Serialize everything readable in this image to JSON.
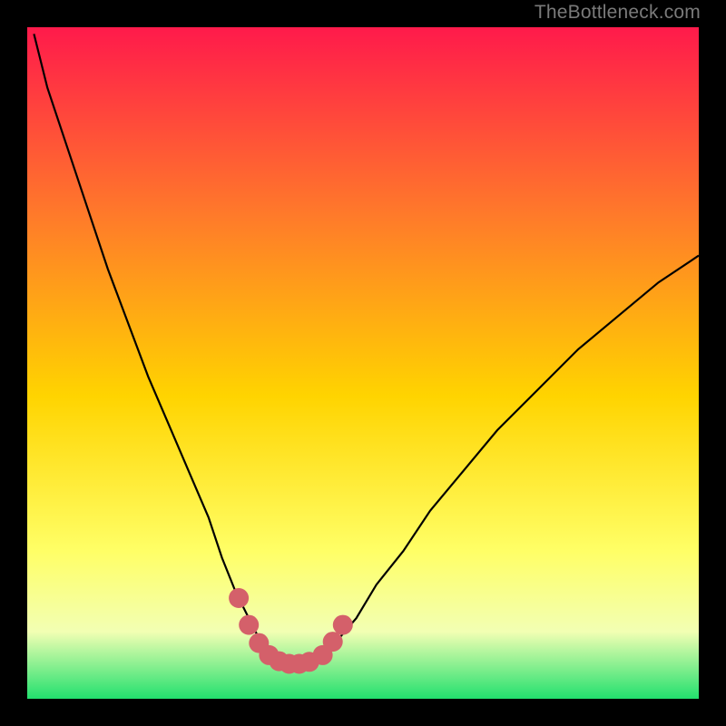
{
  "watermark": "TheBottleneck.com",
  "colors": {
    "bg": "#000000",
    "curve": "#000000",
    "marker_fill": "#d4606a",
    "marker_stroke": "#d4606a",
    "grad_top": "#ff1a4b",
    "grad_mid1": "#ff7a2a",
    "grad_mid2": "#ffd400",
    "grad_mid3": "#ffff66",
    "grad_mid4": "#f2ffb3",
    "grad_bot": "#22e06e"
  },
  "chart_data": {
    "type": "line",
    "title": "",
    "xlabel": "",
    "ylabel": "",
    "xlim": [
      0,
      100
    ],
    "ylim": [
      0,
      100
    ],
    "grid": false,
    "legend": false,
    "series": [
      {
        "name": "bottleneck-curve",
        "x": [
          1,
          3,
          6,
          9,
          12,
          15,
          18,
          21,
          24,
          27,
          29,
          31,
          33,
          34.5,
          36,
          37.5,
          39,
          40.5,
          42,
          44,
          46,
          49,
          52,
          56,
          60,
          65,
          70,
          76,
          82,
          88,
          94,
          100
        ],
        "y": [
          99,
          91,
          82,
          73,
          64,
          56,
          48,
          41,
          34,
          27,
          21,
          16,
          12,
          9,
          7,
          5.8,
          5.3,
          5.2,
          5.4,
          6.2,
          8.5,
          12,
          17,
          22,
          28,
          34,
          40,
          46,
          52,
          57,
          62,
          66
        ]
      }
    ],
    "markers": {
      "name": "highlight-dots",
      "x": [
        31.5,
        33,
        34.5,
        36,
        37.5,
        39,
        40.5,
        42,
        44,
        45.5,
        47
      ],
      "y": [
        15,
        11,
        8.3,
        6.5,
        5.6,
        5.2,
        5.2,
        5.5,
        6.5,
        8.5,
        11
      ]
    }
  }
}
